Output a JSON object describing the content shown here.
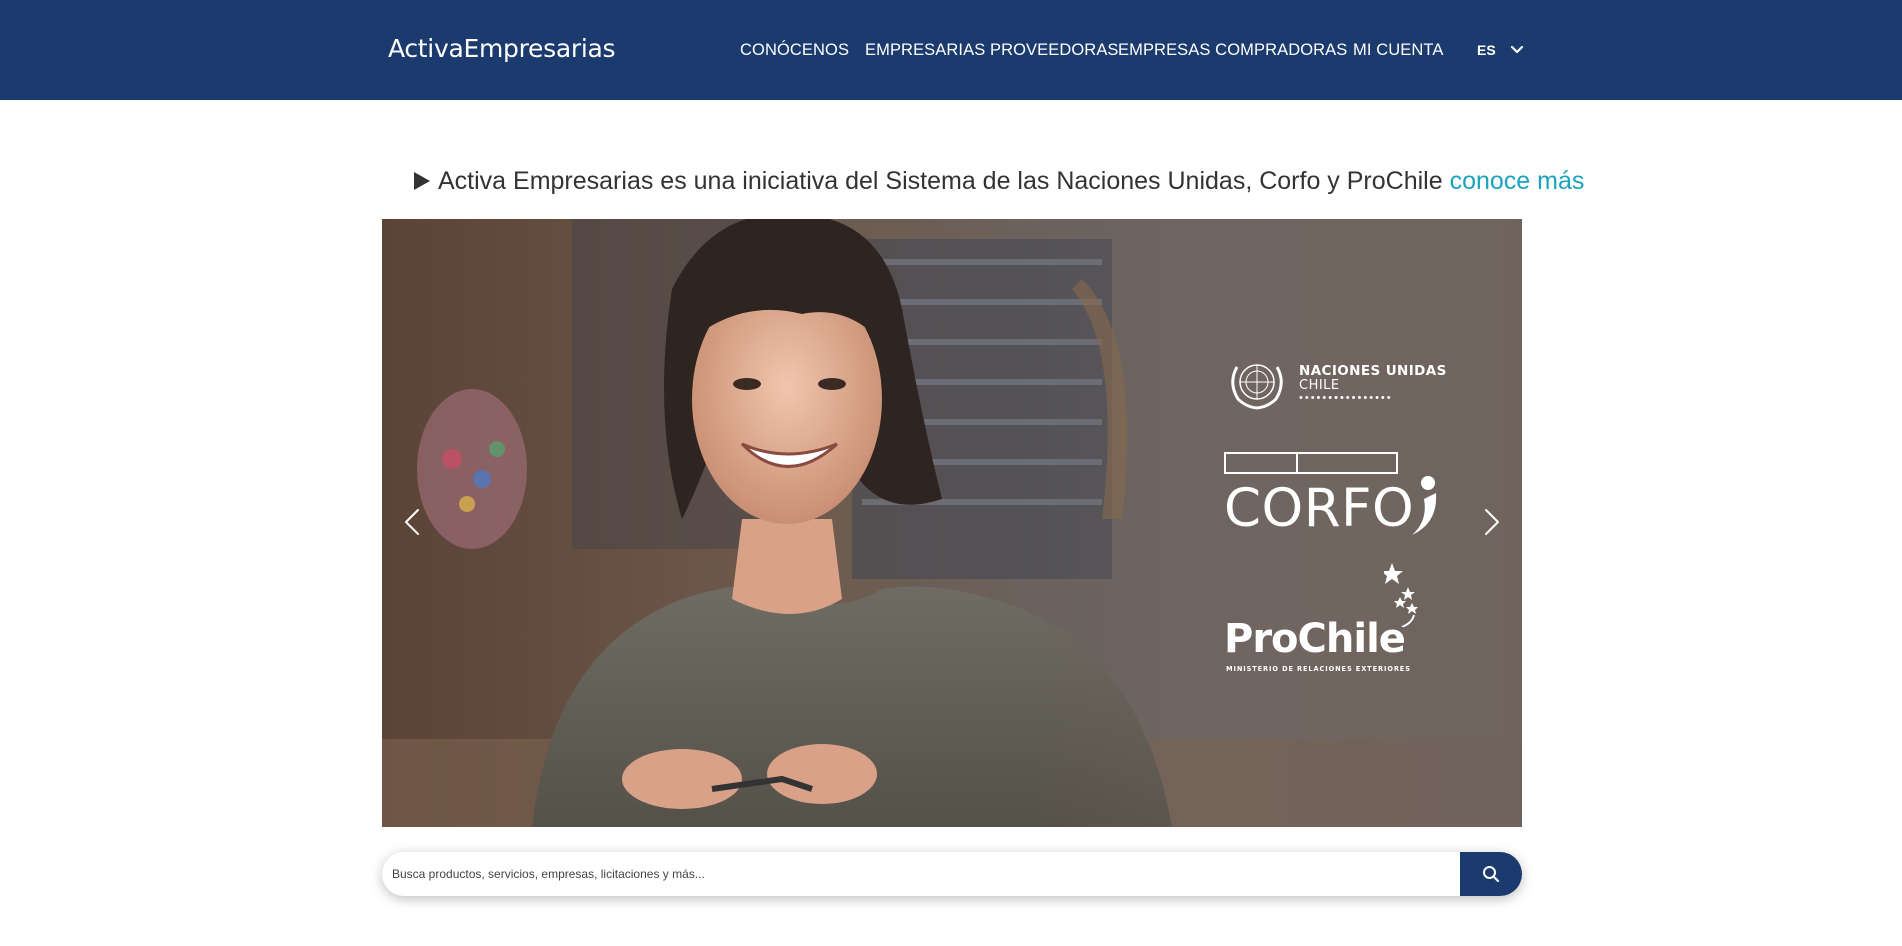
{
  "header": {
    "logo": "ActivaEmpresarias",
    "nav": [
      {
        "label": "CONÓCENOS"
      },
      {
        "label": "EMPRESARIAS PROVEEDORAS"
      },
      {
        "label": "EMPRESAS COMPRADORAS"
      },
      {
        "label": "MI CUENTA"
      }
    ],
    "language": "ES",
    "background_color": "#1b3a6d"
  },
  "intro": {
    "text": "Activa Empresarias es una iniciativa del Sistema de las Naciones Unidas, Corfo y ProChile",
    "link_label": "conoce más",
    "link_color": "#1aa3bd"
  },
  "hero": {
    "icons": {
      "previous": "chevron-left-icon",
      "next": "chevron-right-icon"
    },
    "partners": {
      "un_title": "NACIONES UNIDAS",
      "un_subtitle": "CHILE",
      "un_dots": "••••••••••••••••",
      "corfo": "CORFO",
      "prochile": "ProChile",
      "prochile_subtitle": "MINISTERIO DE RELACIONES EXTERIORES"
    }
  },
  "search": {
    "placeholder": "Busca productos, servicios, empresas, licitaciones y más...",
    "value": "",
    "button_icon": "search-icon"
  }
}
